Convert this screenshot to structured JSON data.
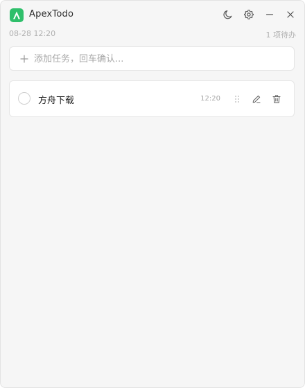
{
  "app": {
    "title": "ApexTodo",
    "logo_letter": "A",
    "accent": "#2fbf6b"
  },
  "titlebar": {
    "icons": [
      "moon-icon",
      "settings-gear-icon",
      "minimize-icon",
      "close-icon"
    ]
  },
  "meta": {
    "datetime": "08-28 12:20",
    "pending": "1 项待办"
  },
  "add_task": {
    "placeholder": "添加任务，回车确认...",
    "value": ""
  },
  "tasks": [
    {
      "text": "方舟下载",
      "time": "12:20",
      "completed": false
    }
  ]
}
